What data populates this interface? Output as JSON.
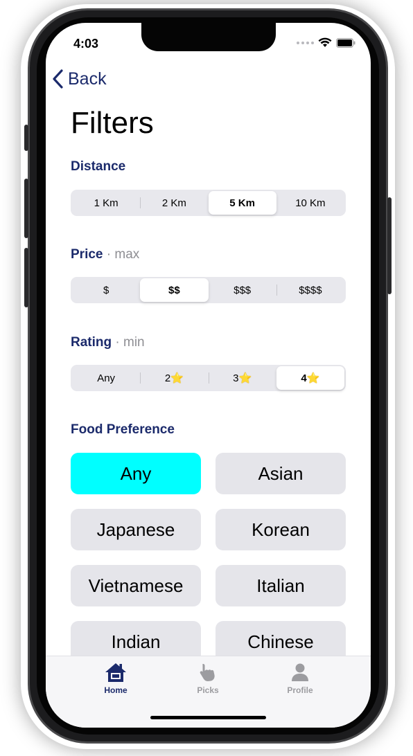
{
  "status": {
    "time": "4:03"
  },
  "nav": {
    "back_label": "Back"
  },
  "page": {
    "title": "Filters"
  },
  "distance": {
    "label": "Distance",
    "options": [
      "1 Km",
      "2 Km",
      "5 Km",
      "10 Km"
    ],
    "selected_index": 2
  },
  "price": {
    "label": "Price",
    "sublabel": "· max",
    "options": [
      "$",
      "$$",
      "$$$",
      "$$$$"
    ],
    "selected_index": 1
  },
  "rating": {
    "label": "Rating",
    "sublabel": "· min",
    "options": [
      "Any",
      "2",
      "3",
      "4"
    ],
    "option_icons": [
      "",
      "star-icon",
      "star-icon",
      "star-icon"
    ],
    "star_glyph": "⭐",
    "selected_index": 3
  },
  "food": {
    "label": "Food Preference",
    "options": [
      "Any",
      "Asian",
      "Japanese",
      "Korean",
      "Vietnamese",
      "Italian",
      "Indian",
      "Chinese"
    ],
    "selected": "Any",
    "selected_color": "#00ffff"
  },
  "tabbar": {
    "items": [
      {
        "label": "Home",
        "icon": "home-icon",
        "active": true
      },
      {
        "label": "Picks",
        "icon": "hand-pointer-icon",
        "active": false
      },
      {
        "label": "Profile",
        "icon": "person-icon",
        "active": false
      }
    ]
  },
  "colors": {
    "accent": "#1b2a6b",
    "inactive": "#9c9ca0",
    "segment_bg": "#e8e8ed",
    "chip_bg": "#e5e5ea"
  }
}
